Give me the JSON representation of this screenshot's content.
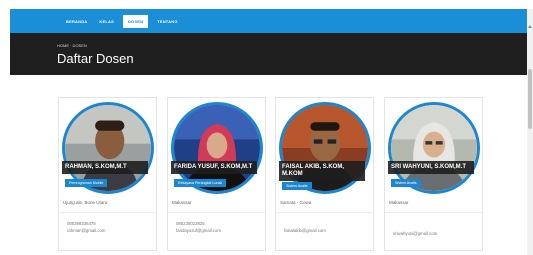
{
  "nav": {
    "items": [
      {
        "label": "BERANDA",
        "active": false
      },
      {
        "label": "KELAS",
        "active": false
      },
      {
        "label": "DOSEN",
        "active": true
      },
      {
        "label": "TENTANG",
        "active": false
      }
    ]
  },
  "header": {
    "breadcrumb": "HOME · DOSEN",
    "title": "Daftar Dosen"
  },
  "colors": {
    "brand": "#1a8ed6",
    "header": "#1f1f1f",
    "badge": "#1c87cf"
  },
  "lecturers": [
    {
      "name": "RAHMAN, S.KOM,M.T",
      "badge": "Pemrograman Mobile",
      "location": "Ujung.ale, Bone Utara",
      "phone": "085398336478",
      "email": "rahman@gmail.com"
    },
    {
      "name": "FARIDA YUSUF, S.KOM,M.T",
      "badge": "Rekayasa Perangkat Lunak",
      "location": "Makassar",
      "phone": "085238023825",
      "email": "faridayusuf@gmail.com"
    },
    {
      "name": "FAISAL AKIB, S.KOM, M.KOM",
      "badge": "Sistem Analis",
      "location": "Samata - Gowa",
      "phone": "",
      "email": "faisalakib@gmail.com"
    },
    {
      "name": "SRI WAHYUNI, S.KOM,M.T",
      "badge": "Sistem Analis",
      "location": "Makassar",
      "phone": "",
      "email": "sriwahyuni@gmail.com"
    }
  ]
}
